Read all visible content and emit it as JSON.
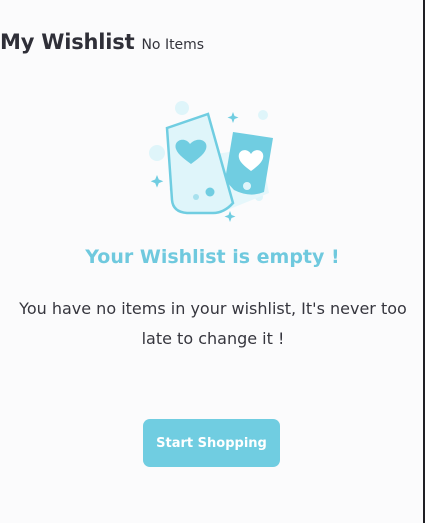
{
  "header": {
    "title": "My Wishlist",
    "count_label": "No Items"
  },
  "empty_state": {
    "illustration_icon": "wishlist-tags-icon",
    "title": "Your Wishlist is empty !",
    "message": "You have no items in your wishlist, It's never too late to change it !",
    "button_label": "Start Shopping"
  },
  "colors": {
    "accent": "#70cde1",
    "accent_light": "#dff5fa",
    "text_dark": "#36363e",
    "background": "#fbfbfc"
  }
}
